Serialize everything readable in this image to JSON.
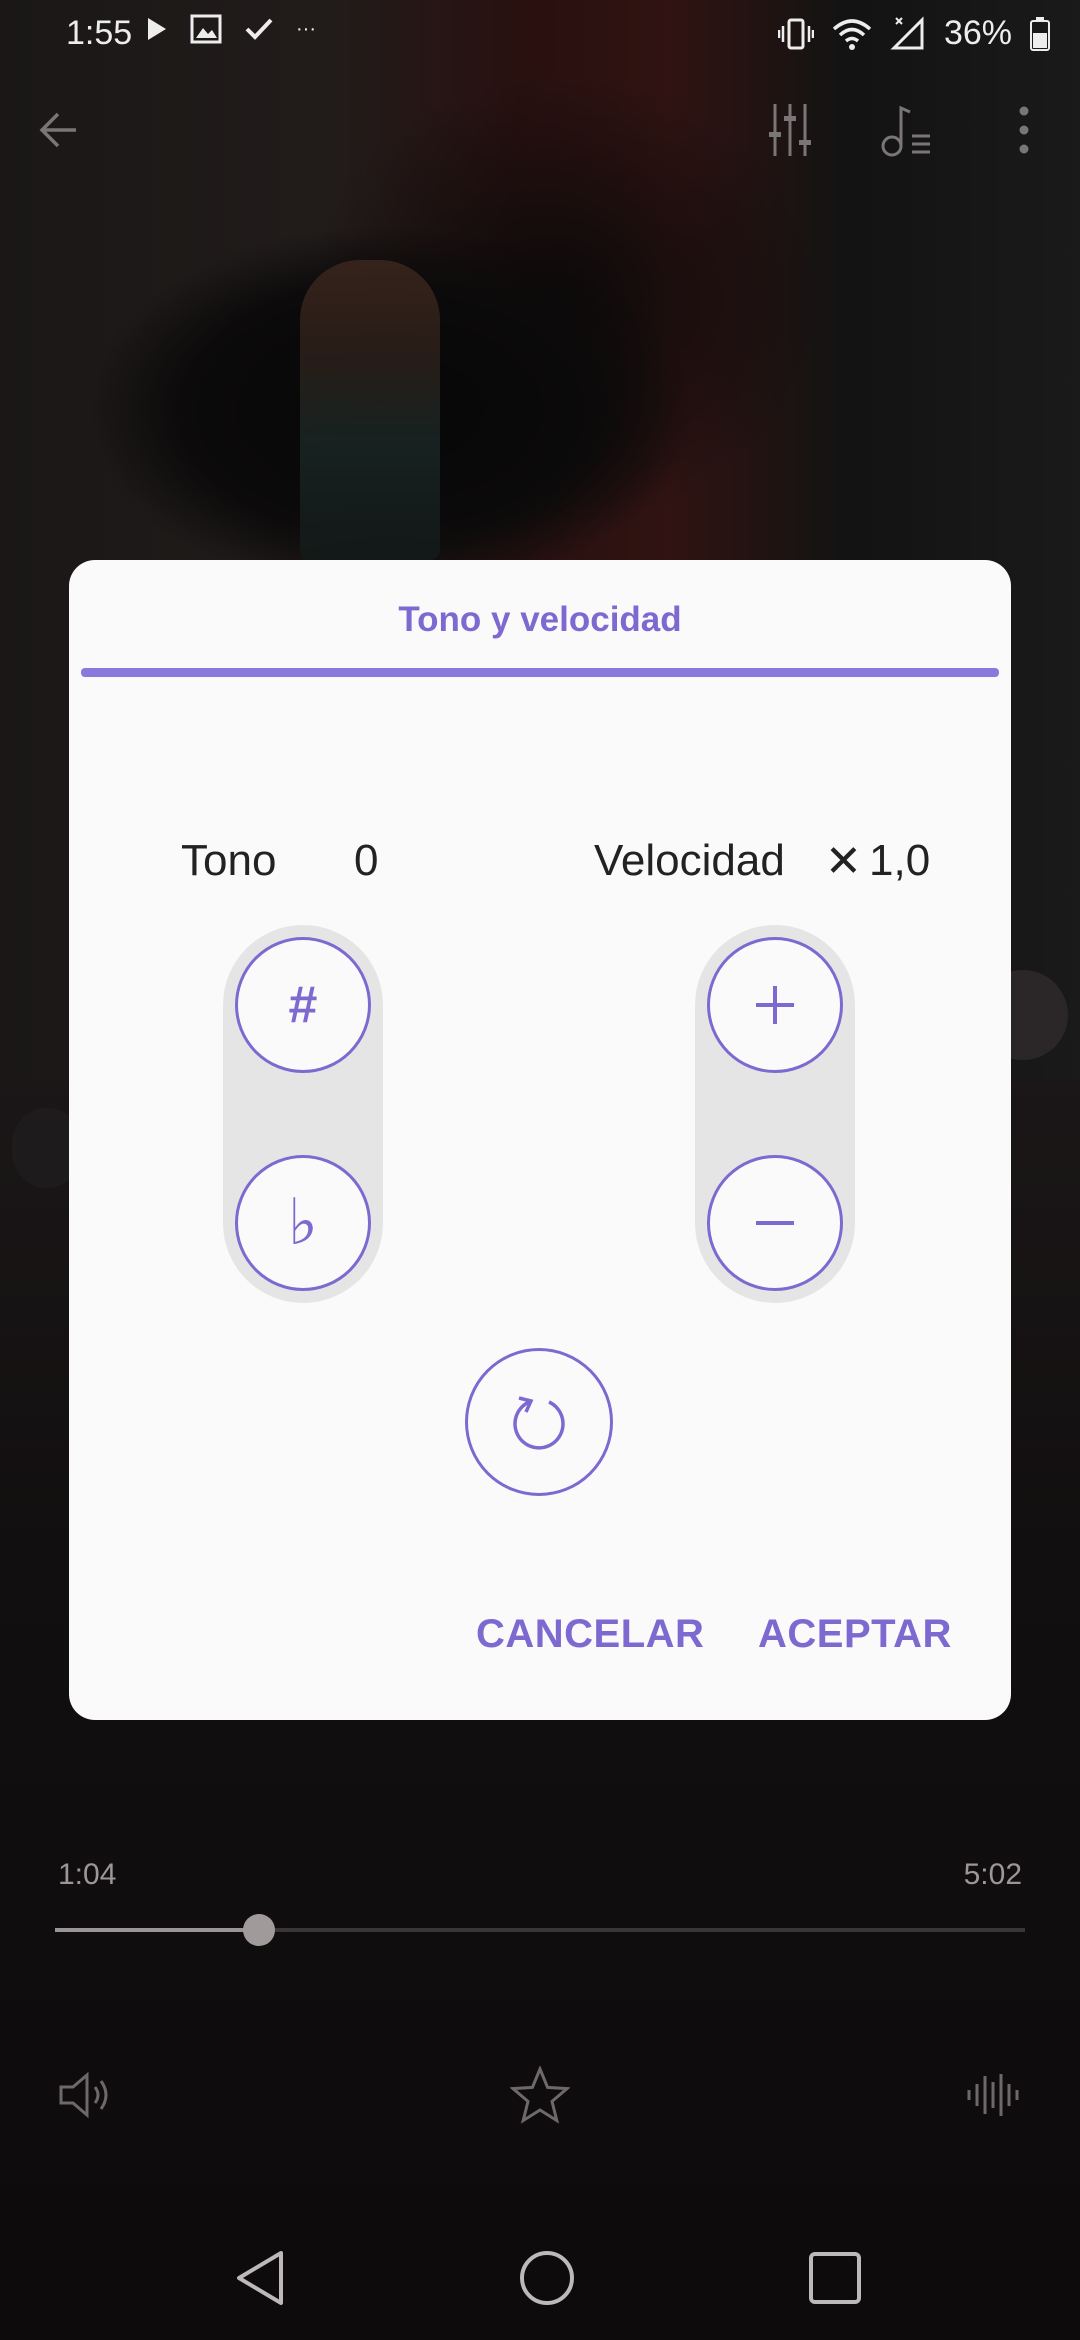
{
  "status_bar": {
    "time": "1:55",
    "battery": "36%",
    "more_glyph": "···"
  },
  "player": {
    "current_time": "1:04",
    "total_time": "5:02",
    "progress_fraction": 0.21
  },
  "dialog": {
    "title": "Tono y velocidad",
    "pitch_label": "Tono",
    "pitch_value": "0",
    "speed_label": "Velocidad",
    "speed_value": "1,0",
    "speed_prefix_glyph": "✕",
    "sharp_glyph": "#",
    "flat_glyph": "♭",
    "plus_glyph": "+",
    "minus_glyph": "−",
    "cancel_label": "CANCELAR",
    "accept_label": "ACEPTAR"
  },
  "colors": {
    "accent": "#7e69d0",
    "dialog_bg": "#fafafa"
  }
}
